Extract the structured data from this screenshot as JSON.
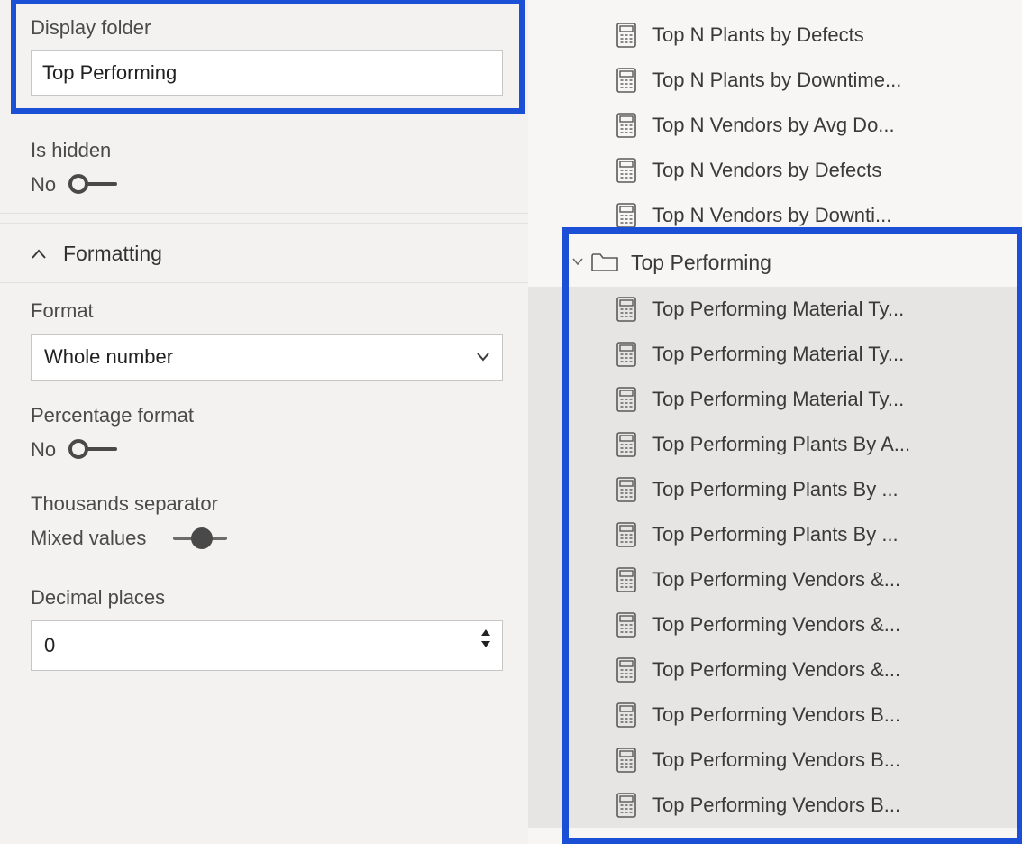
{
  "left": {
    "displayFolder": {
      "label": "Display folder",
      "value": "Top Performing"
    },
    "isHidden": {
      "label": "Is hidden",
      "valueText": "No"
    },
    "formatting": {
      "header": "Formatting",
      "format": {
        "label": "Format",
        "value": "Whole number"
      },
      "percentageFormat": {
        "label": "Percentage format",
        "valueText": "No"
      },
      "thousandsSeparator": {
        "label": "Thousands separator",
        "valueText": "Mixed values"
      },
      "decimalPlaces": {
        "label": "Decimal places",
        "value": "0"
      }
    }
  },
  "right": {
    "topItems": [
      "Top N Plants by Defects",
      "Top N Plants by Downtime...",
      "Top N Vendors by Avg Do...",
      "Top N Vendors by Defects",
      "Top N Vendors by Downti..."
    ],
    "folder": {
      "name": "Top Performing",
      "items": [
        "Top Performing Material Ty...",
        "Top Performing Material Ty...",
        "Top Performing Material Ty...",
        "Top Performing Plants By A...",
        "Top Performing Plants By ...",
        "Top Performing Plants By ...",
        "Top Performing Vendors &...",
        "Top Performing Vendors &...",
        "Top Performing Vendors &...",
        "Top Performing Vendors B...",
        "Top Performing Vendors B...",
        "Top Performing Vendors B..."
      ]
    }
  }
}
